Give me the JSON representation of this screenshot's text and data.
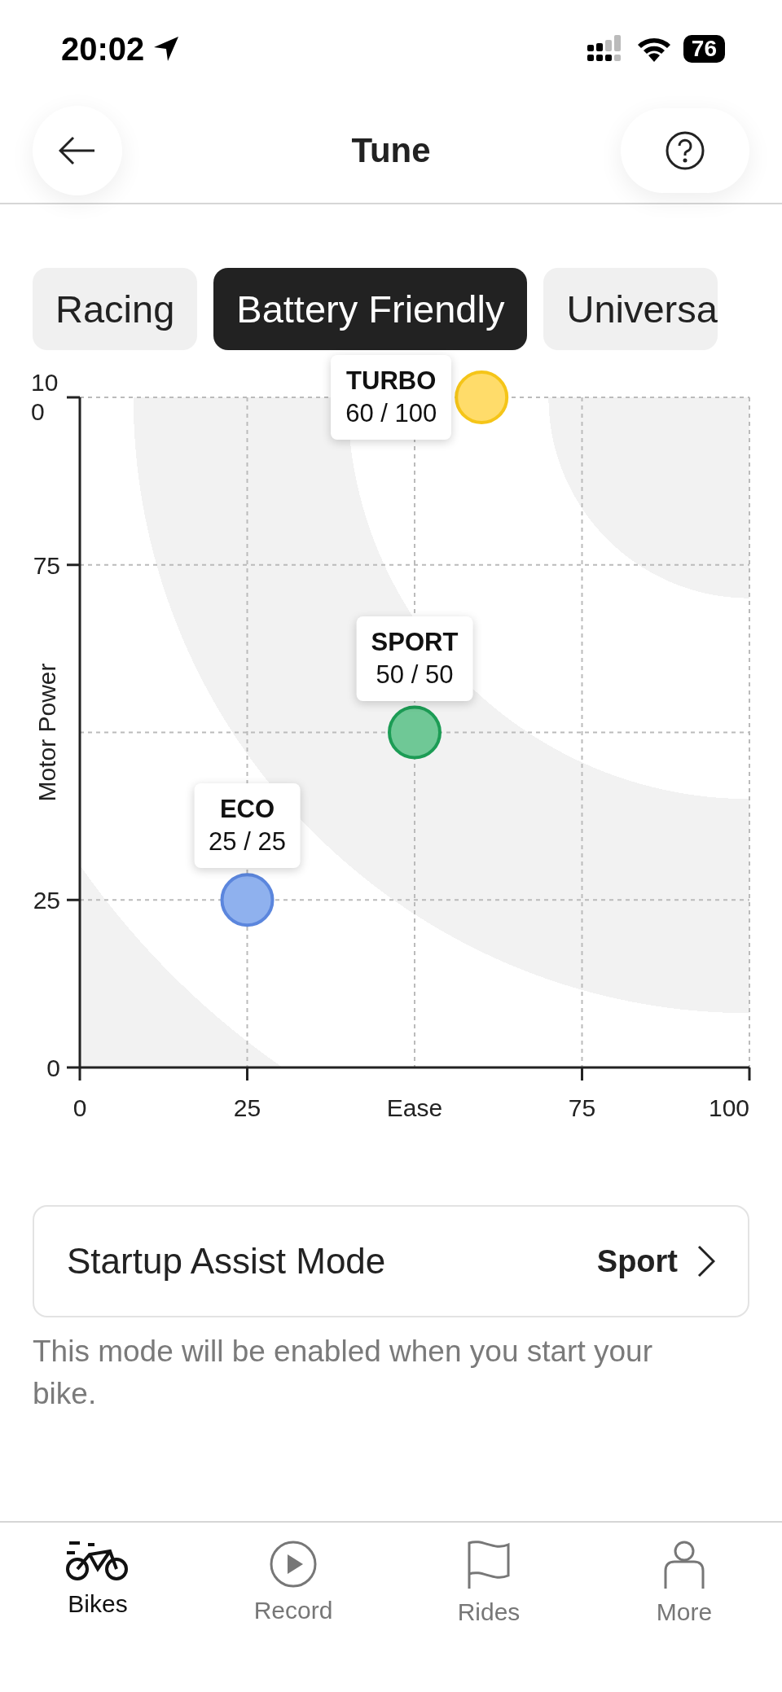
{
  "status_bar": {
    "time": "20:02",
    "battery": "76"
  },
  "header": {
    "title": "Tune"
  },
  "tabs": [
    {
      "label": "Racing",
      "selected": false
    },
    {
      "label": "Battery Friendly",
      "selected": true
    },
    {
      "label": "Universa",
      "selected": false
    }
  ],
  "chart_data": {
    "type": "scatter",
    "grid": true,
    "xlabel": "Ease",
    "ylabel": "Motor Power",
    "x": [
      25,
      50,
      60
    ],
    "xlim": [
      0,
      100
    ],
    "ylim": [
      0,
      100
    ],
    "xticks": [
      0,
      25,
      75,
      100
    ],
    "yticks": [
      0,
      25,
      75,
      {
        "value": 100,
        "label": "100"
      }
    ],
    "series": [
      {
        "name": "ECO",
        "color": "#8fb1ee",
        "values": [
          25,
          null,
          null
        ],
        "value_labels": [
          "25 / 25",
          null,
          null
        ]
      },
      {
        "name": "SPORT",
        "color": "#6fc896",
        "values": [
          null,
          50,
          null
        ],
        "value_labels": [
          null,
          "50 / 50",
          null
        ]
      },
      {
        "name": "TURBO",
        "color": "#ffdc6a",
        "values": [
          null,
          null,
          100
        ],
        "value_labels": [
          null,
          null,
          "60 / 100"
        ]
      }
    ]
  },
  "startup": {
    "label": "Startup Assist Mode",
    "value": "Sport",
    "hint": "This mode will be enabled when you start your bike."
  },
  "nav": [
    {
      "label": "Bikes",
      "kind": "bike",
      "selected": true
    },
    {
      "label": "Record",
      "kind": "record",
      "selected": false
    },
    {
      "label": "Rides",
      "kind": "flag",
      "selected": false
    },
    {
      "label": "More",
      "kind": "person",
      "selected": false
    }
  ]
}
